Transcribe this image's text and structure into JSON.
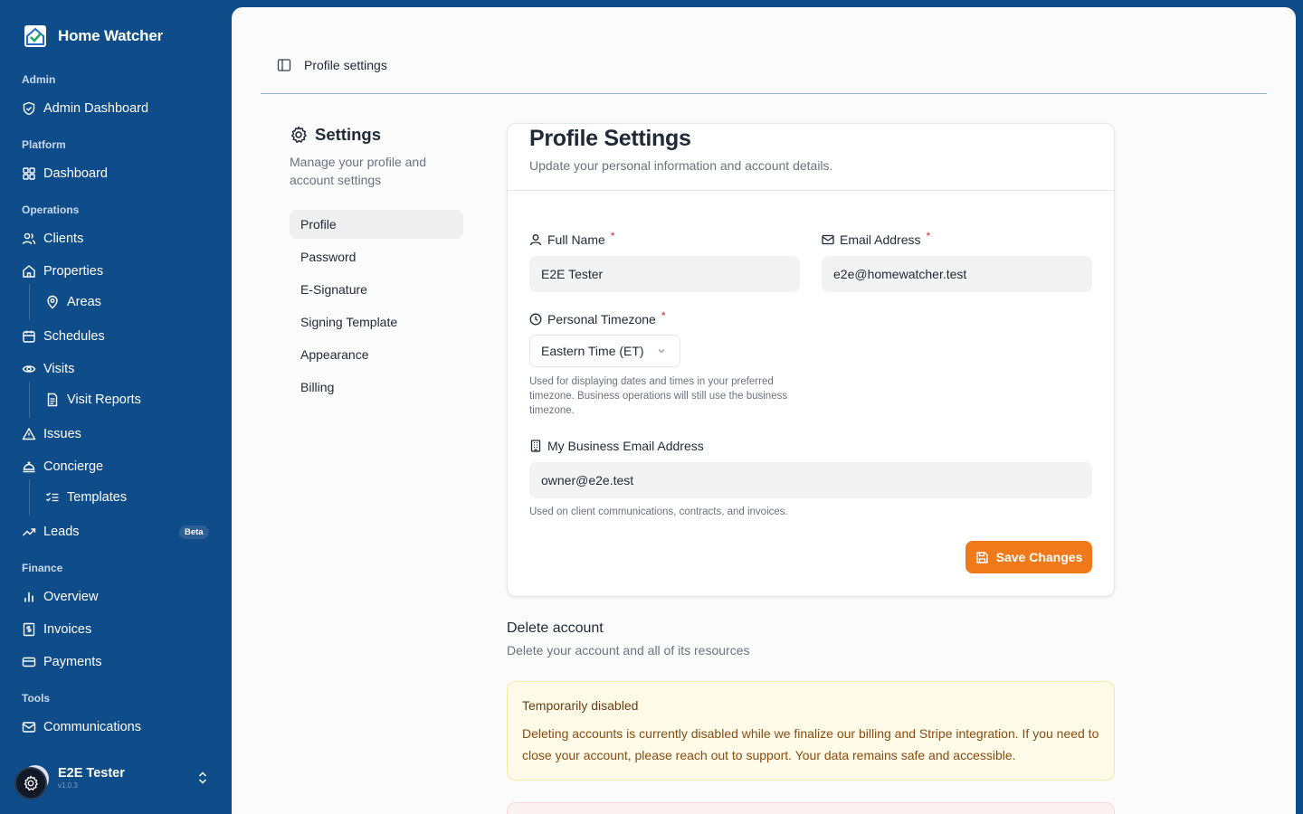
{
  "brand": {
    "name": "Home Watcher",
    "logo_icon": "house-check-icon"
  },
  "nav": {
    "admin_label": "Admin",
    "admin_dashboard": "Admin Dashboard",
    "platform_label": "Platform",
    "dashboard": "Dashboard",
    "operations_label": "Operations",
    "clients": "Clients",
    "properties": "Properties",
    "areas": "Areas",
    "schedules": "Schedules",
    "visits": "Visits",
    "visit_reports": "Visit Reports",
    "issues": "Issues",
    "concierge": "Concierge",
    "templates": "Templates",
    "leads": "Leads",
    "leads_badge": "Beta",
    "finance_label": "Finance",
    "overview": "Overview",
    "invoices": "Invoices",
    "payments": "Payments",
    "tools_label": "Tools",
    "communications": "Communications"
  },
  "user": {
    "name": "E2E Tester",
    "version": "v1.0.3"
  },
  "topbar": {
    "title": "Profile settings"
  },
  "settings": {
    "title": "Settings",
    "subtitle": "Manage your profile and account settings",
    "menu": [
      "Profile",
      "Password",
      "E-Signature",
      "Signing Template",
      "Appearance",
      "Billing"
    ],
    "active": "Profile"
  },
  "profile_card": {
    "title": "Profile Settings",
    "subtitle": "Update your personal information and account details.",
    "full_name_label": "Full Name",
    "full_name_value": "E2E Tester",
    "email_label": "Email Address",
    "email_value": "e2e@homewatcher.test",
    "timezone_label": "Personal Timezone",
    "timezone_value": "Eastern Time (ET)",
    "timezone_help": "Used for displaying dates and times in your preferred timezone. Business operations will still use the business timezone.",
    "business_email_label": "My Business Email Address",
    "business_email_value": "owner@e2e.test",
    "business_email_help": "Used on client communications, contracts, and invoices.",
    "required_marker": "*",
    "save_label": "Save Changes"
  },
  "delete_account": {
    "title": "Delete account",
    "subtitle": "Delete your account and all of its resources",
    "warning_title": "Temporarily disabled",
    "warning_text": "Deleting accounts is currently disabled while we finalize our billing and Stripe integration. If you need to close your account, please reach out to support. Your data remains safe and accessible."
  },
  "colors": {
    "sidebar_bg": "#0f4c8a",
    "accent_orange": "#f07a1a",
    "warning_bg": "#fefbe8",
    "required_red": "#dc2626"
  }
}
